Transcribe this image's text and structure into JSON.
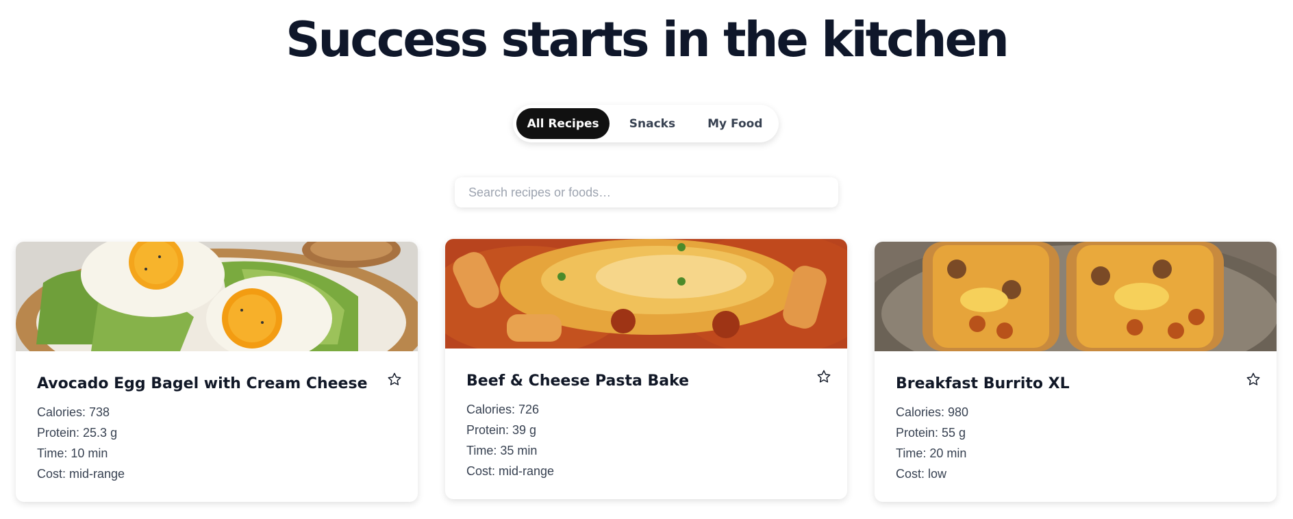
{
  "page": {
    "title": "Success starts in the kitchen"
  },
  "tabs": [
    {
      "label": "All Recipes",
      "active": true
    },
    {
      "label": "Snacks",
      "active": false
    },
    {
      "label": "My Food",
      "active": false
    }
  ],
  "search": {
    "placeholder": "Search recipes or foods…",
    "value": ""
  },
  "recipes": [
    {
      "title": "Avocado Egg Bagel with Cream Cheese",
      "calories": "Calories: 738",
      "protein": "Protein: 25.3 g",
      "time": "Time: 10 min",
      "cost": "Cost: mid-range",
      "favorite_icon": "star-outline-icon"
    },
    {
      "title": "Beef & Cheese Pasta Bake",
      "calories": "Calories: 726",
      "protein": "Protein: 39 g",
      "time": "Time: 35 min",
      "cost": "Cost: mid-range",
      "favorite_icon": "star-outline-icon"
    },
    {
      "title": "Breakfast Burrito XL",
      "calories": "Calories: 980",
      "protein": "Protein: 55 g",
      "time": "Time: 20 min",
      "cost": "Cost: low",
      "favorite_icon": "star-outline-icon"
    }
  ],
  "colors": {
    "title": "#0f172a",
    "active_tab_bg": "#111111",
    "active_tab_text": "#ffffff",
    "tab_text": "#374151",
    "stat_text": "#374151",
    "placeholder": "#9ca3af"
  }
}
